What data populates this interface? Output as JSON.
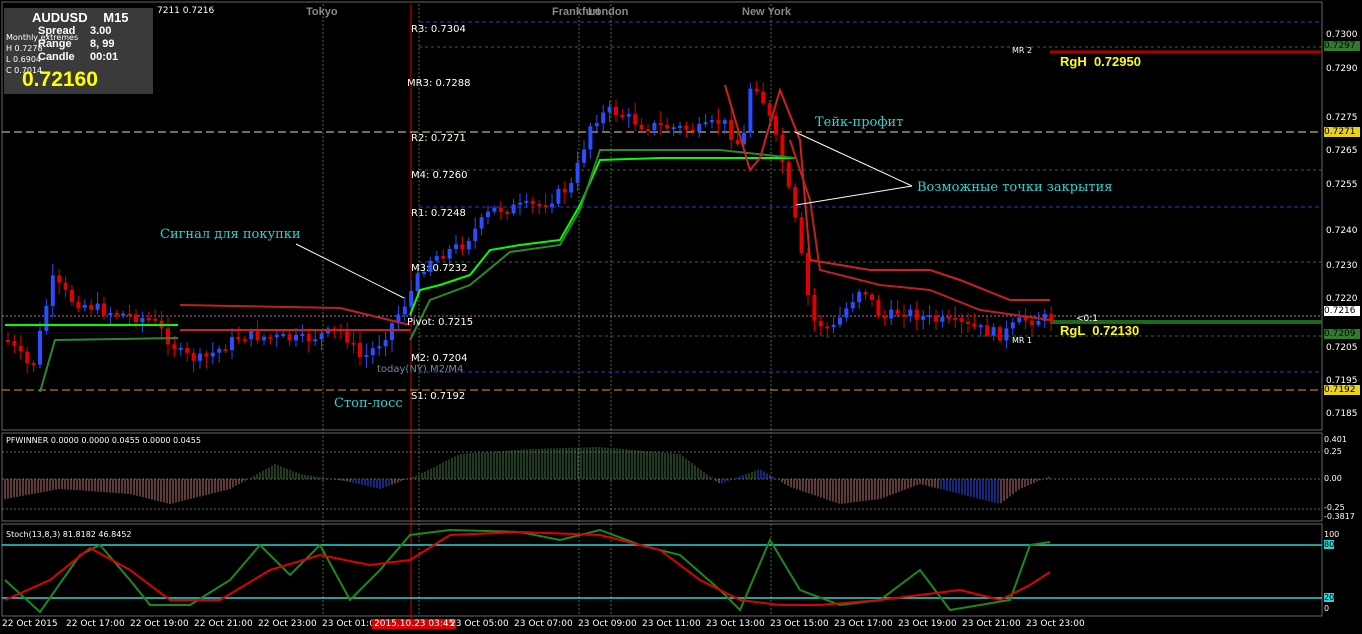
{
  "symbol": "AUDUSD",
  "timeframe": "M15",
  "info_rows": [
    {
      "label": "Spread",
      "value": "3.00"
    },
    {
      "label": "Range",
      "value": "8, 99"
    },
    {
      "label": "Candle",
      "value": "00:01"
    }
  ],
  "info_small": [
    "Monthly extremes",
    "H 0.7278",
    "L 0.6904",
    "C 0.7014"
  ],
  "current_price": "0.72160",
  "top_quote": "7211 0.7216",
  "sessions": [
    "Tokyo",
    "Frankfurt",
    "London",
    "New York"
  ],
  "pivot_labels": [
    "R3: 0.7304",
    "MR3: 0.7288",
    "R2: 0.7271",
    "M4: 0.7260",
    "R1: 0.7248",
    "M3: 0.7232",
    "Pivot: 0.7215",
    "M2: 0.7204",
    "S1: 0.7192"
  ],
  "today_label": "today(NY) M2/M4",
  "mr_labels": [
    "MR 2",
    "MR 1"
  ],
  "rgh_label": "RgH  0.72950",
  "rgl_label": "RgL  0.72130",
  "rgl_small": "<0:1",
  "price_axis_ticks": [
    "0.7300",
    "0.7290",
    "0.7275",
    "0.7265",
    "0.7255",
    "0.7240",
    "0.7230",
    "0.7220",
    "0.7205",
    "0.7195",
    "0.7185"
  ],
  "price_badges": [
    {
      "text": "0.7297",
      "color": "#2e7d2e"
    },
    {
      "text": "0.7271",
      "color": "#e8d21a"
    },
    {
      "text": "0.7216",
      "color": "#ffffff"
    },
    {
      "text": "0.7209",
      "color": "#2e7d2e"
    },
    {
      "text": "0.7192",
      "color": "#e8d21a"
    }
  ],
  "annotations": {
    "buy_signal": "Сигнал для покупки",
    "stop_loss": "Стоп-лосс",
    "take_profit": "Тейк-профит",
    "close_points": "Возможные точки закрытия"
  },
  "pfwinner": {
    "title": "PFWINNER 0.0000 0.0000 0.0455 0.0000 0.0455",
    "axis": [
      "0.401",
      "0.25",
      "0.00",
      "-0.25",
      "-0.3817"
    ]
  },
  "stoch": {
    "title": "Stoch(13,8,3) 81.8182 46.8452",
    "axis": [
      "100",
      "80",
      "20",
      "0"
    ]
  },
  "time_axis": [
    "22 Oct 2015",
    "22 Oct 17:00",
    "22 Oct 19:00",
    "22 Oct 21:00",
    "22 Oct 23:00",
    "23 Oct 01:00",
    "2015.10.23 03:45",
    "23 Oct 05:00",
    "23 Oct 07:00",
    "23 Oct 09:00",
    "23 Oct 11:00",
    "23 Oct 13:00",
    "23 Oct 15:00",
    "23 Oct 17:00",
    "23 Oct 19:00",
    "23 Oct 21:00",
    "23 Oct 23:00"
  ],
  "colors": {
    "bull": "#2a4dff",
    "bear": "#e00000",
    "annotation": "#2bd4d4",
    "info_bg": "#3a3a3a",
    "price_yellow": "#ffff00"
  }
}
